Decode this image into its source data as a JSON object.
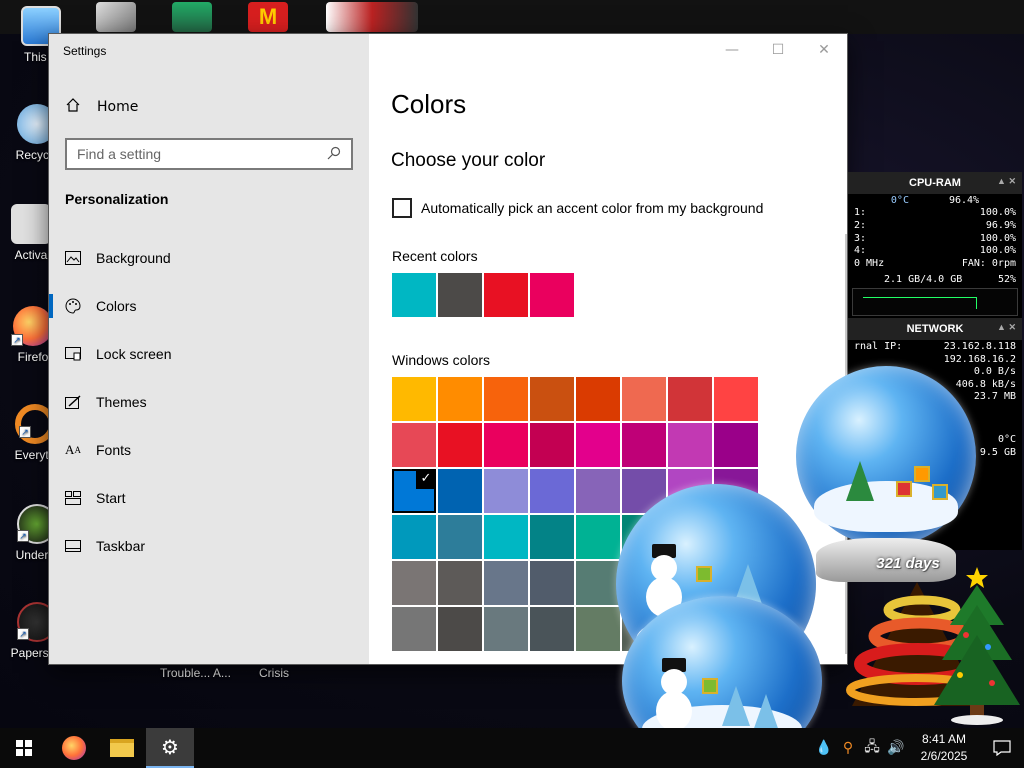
{
  "window": {
    "title": "Settings",
    "minimize": "—",
    "maximize": "☐",
    "close": "✕"
  },
  "sidebar": {
    "home_label": "Home",
    "search_placeholder": "Find a setting",
    "section_title": "Personalization",
    "items": [
      {
        "label": "Background",
        "icon": "picture-icon"
      },
      {
        "label": "Colors",
        "icon": "palette-icon",
        "active": true
      },
      {
        "label": "Lock screen",
        "icon": "lock-screen-icon"
      },
      {
        "label": "Themes",
        "icon": "brush-icon"
      },
      {
        "label": "Fonts",
        "icon": "font-icon"
      },
      {
        "label": "Start",
        "icon": "start-grid-icon"
      },
      {
        "label": "Taskbar",
        "icon": "taskbar-icon"
      }
    ]
  },
  "content": {
    "page_title": "Colors",
    "subtitle": "Choose your color",
    "auto_accent_label": "Automatically pick an accent color from my background",
    "recent_label": "Recent colors",
    "windows_label": "Windows colors",
    "recent_colors": [
      "#00b7c3",
      "#4c4a48",
      "#e81123",
      "#ea005e"
    ],
    "windows_colors": [
      "#ffb900",
      "#ff8c00",
      "#f7630c",
      "#ca5010",
      "#da3b01",
      "#ef6950",
      "#d13438",
      "#ff4343",
      "#e74856",
      "#e81123",
      "#ea005e",
      "#c30052",
      "#e3008c",
      "#bf0077",
      "#c239b3",
      "#9a0089",
      "#0078d7",
      "#0063b1",
      "#8e8cd8",
      "#6b69d6",
      "#8764b8",
      "#744da9",
      "#b146c2",
      "#881798",
      "#0099bc",
      "#2d7d9a",
      "#00b7c3",
      "#038387",
      "#00b294",
      "#018574",
      "#00cc6a",
      "#10893e",
      "#7a7574",
      "#5d5a58",
      "#68768a",
      "#515c6b",
      "#567c73",
      "#486860",
      "#498205",
      "#107c10",
      "#767676",
      "#4c4a48",
      "#69797e",
      "#4a5459",
      "#647c64",
      "#525e54",
      "#847545",
      "#7e735f"
    ],
    "selected_index": 16,
    "selected_mark": "✓"
  },
  "desktop": {
    "icons": [
      {
        "label": "This P",
        "color": "#3a8ee6"
      },
      {
        "label": "Recycle",
        "color": "#5aa0d8"
      },
      {
        "label": "Activa",
        "color": "#d8d8d8"
      },
      {
        "label": "Firefo",
        "color": "#ff7139"
      },
      {
        "label": "Everyth",
        "color": "#f08a24"
      },
      {
        "label": "Underta",
        "color": "#2a2a2a"
      },
      {
        "label": "Papers, P",
        "color": "#1a1a1a"
      }
    ],
    "bottom_labels": [
      "Trouble... A...",
      "Crisis"
    ]
  },
  "gadget": {
    "cpu_title": "CPU-RAM",
    "temp": "0°C",
    "cpu_total": "96.4%",
    "cores": [
      {
        "label": "1:",
        "value": "100.0%"
      },
      {
        "label": "2:",
        "value": "96.9%"
      },
      {
        "label": "3:",
        "value": "100.0%"
      },
      {
        "label": "4:",
        "value": "100.0%"
      }
    ],
    "freq": "0 MHz",
    "fan": "FAN: 0rpm",
    "ram": "2.1 GB/4.0 GB",
    "ram_pct": "52%",
    "net_title": "NETWORK",
    "internal_ip_label": "rnal IP:",
    "internal_ip": "23.162.8.118",
    "local_ip": "192.168.16.2",
    "upload": "0.0 B/s",
    "download": "406.8 kB/s",
    "total": "23.7 MB",
    "temp2": "0°C",
    "disk": "9.5 GB"
  },
  "globe": {
    "days_text": "321 days"
  },
  "taskbar": {
    "time": "8:41 AM",
    "date": "2/6/2025"
  }
}
